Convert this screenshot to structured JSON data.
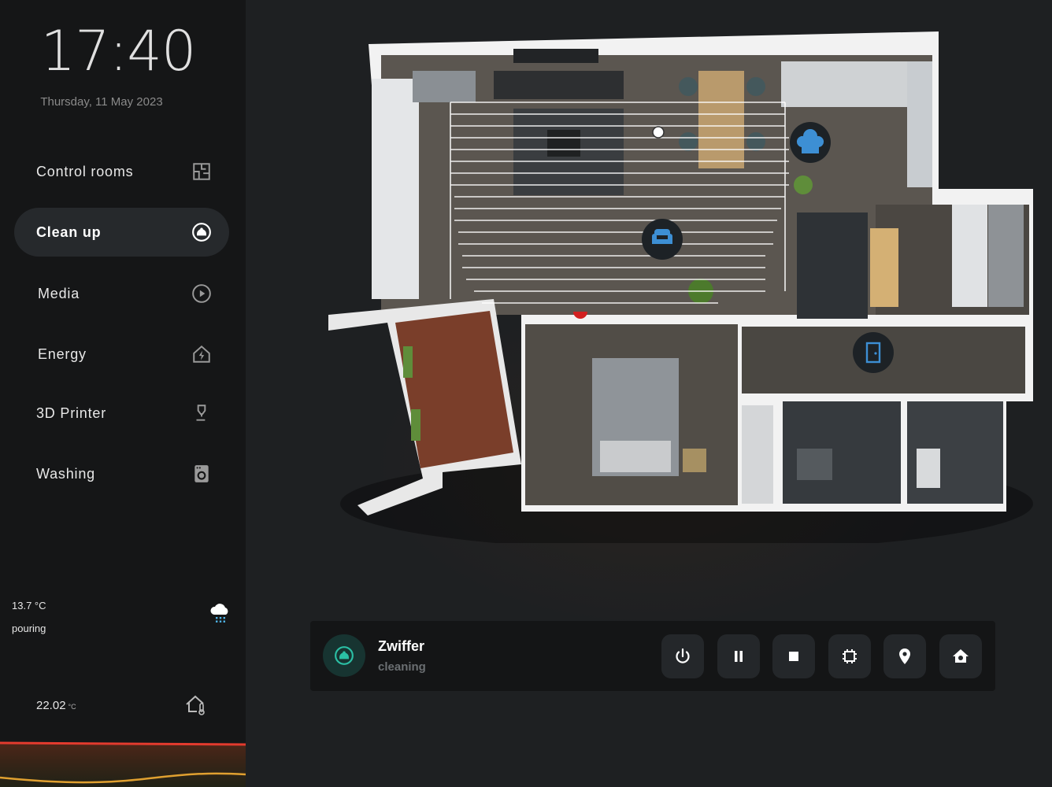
{
  "clock": {
    "time": "17:40",
    "date": "Thursday, 11 May 2023"
  },
  "menu": {
    "items": [
      {
        "label": "Control rooms",
        "icon": "floorplan-icon",
        "active": false
      },
      {
        "label": "Clean up",
        "icon": "robot-vacuum-icon",
        "active": true
      },
      {
        "label": "Media",
        "icon": "play-circle-icon",
        "active": false
      },
      {
        "label": "Energy",
        "icon": "home-lightning-icon",
        "active": false
      },
      {
        "label": "3D Printer",
        "icon": "printer-3d-nozzle-icon",
        "active": false
      },
      {
        "label": "Washing",
        "icon": "washing-machine-icon",
        "active": false
      }
    ]
  },
  "weather": {
    "temperature": "13.7 °C",
    "condition": "pouring",
    "icon": "weather-pouring-icon"
  },
  "indoor": {
    "temperature": "22.02",
    "unit": "°C",
    "icon": "home-thermometer-icon"
  },
  "floorplan": {
    "room_icons": [
      "chef-hat-icon",
      "sofa-icon",
      "door-icon"
    ]
  },
  "vacuum": {
    "name": "Zwiffer",
    "status": "cleaning",
    "controls": [
      "power-icon",
      "pause-icon",
      "stop-icon",
      "select-zone-icon",
      "map-marker-icon",
      "home-dock-icon"
    ]
  },
  "colors": {
    "accent_teal": "#2bbfa4",
    "room_icon_blue": "#3d8fd4",
    "sidebar_bg": "#151617",
    "main_bg": "#1e2022",
    "chart_red": "#e33b2e",
    "chart_orange": "#e0a030"
  }
}
